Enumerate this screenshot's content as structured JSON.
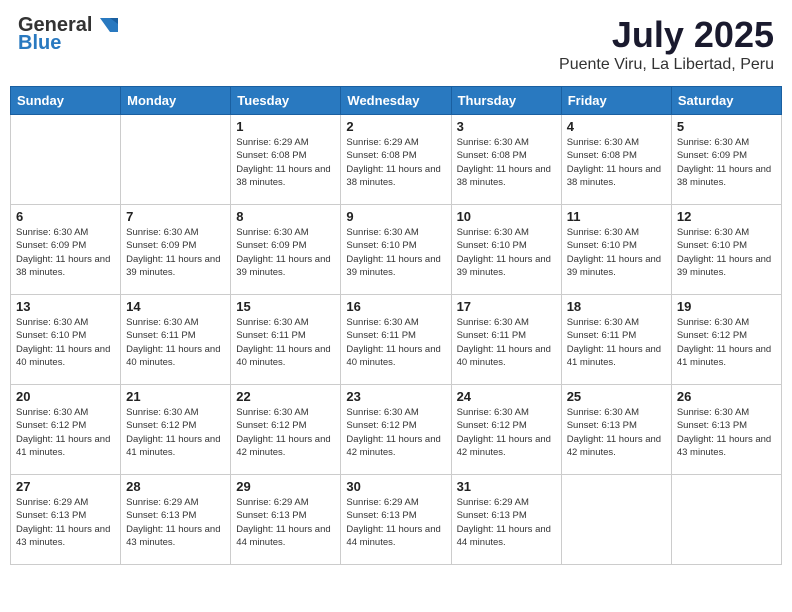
{
  "header": {
    "logo_general": "General",
    "logo_blue": "Blue",
    "title": "July 2025",
    "subtitle": "Puente Viru, La Libertad, Peru"
  },
  "days_of_week": [
    "Sunday",
    "Monday",
    "Tuesday",
    "Wednesday",
    "Thursday",
    "Friday",
    "Saturday"
  ],
  "weeks": [
    [
      {
        "num": "",
        "info": ""
      },
      {
        "num": "",
        "info": ""
      },
      {
        "num": "1",
        "info": "Sunrise: 6:29 AM\nSunset: 6:08 PM\nDaylight: 11 hours and 38 minutes."
      },
      {
        "num": "2",
        "info": "Sunrise: 6:29 AM\nSunset: 6:08 PM\nDaylight: 11 hours and 38 minutes."
      },
      {
        "num": "3",
        "info": "Sunrise: 6:30 AM\nSunset: 6:08 PM\nDaylight: 11 hours and 38 minutes."
      },
      {
        "num": "4",
        "info": "Sunrise: 6:30 AM\nSunset: 6:08 PM\nDaylight: 11 hours and 38 minutes."
      },
      {
        "num": "5",
        "info": "Sunrise: 6:30 AM\nSunset: 6:09 PM\nDaylight: 11 hours and 38 minutes."
      }
    ],
    [
      {
        "num": "6",
        "info": "Sunrise: 6:30 AM\nSunset: 6:09 PM\nDaylight: 11 hours and 38 minutes."
      },
      {
        "num": "7",
        "info": "Sunrise: 6:30 AM\nSunset: 6:09 PM\nDaylight: 11 hours and 39 minutes."
      },
      {
        "num": "8",
        "info": "Sunrise: 6:30 AM\nSunset: 6:09 PM\nDaylight: 11 hours and 39 minutes."
      },
      {
        "num": "9",
        "info": "Sunrise: 6:30 AM\nSunset: 6:10 PM\nDaylight: 11 hours and 39 minutes."
      },
      {
        "num": "10",
        "info": "Sunrise: 6:30 AM\nSunset: 6:10 PM\nDaylight: 11 hours and 39 minutes."
      },
      {
        "num": "11",
        "info": "Sunrise: 6:30 AM\nSunset: 6:10 PM\nDaylight: 11 hours and 39 minutes."
      },
      {
        "num": "12",
        "info": "Sunrise: 6:30 AM\nSunset: 6:10 PM\nDaylight: 11 hours and 39 minutes."
      }
    ],
    [
      {
        "num": "13",
        "info": "Sunrise: 6:30 AM\nSunset: 6:10 PM\nDaylight: 11 hours and 40 minutes."
      },
      {
        "num": "14",
        "info": "Sunrise: 6:30 AM\nSunset: 6:11 PM\nDaylight: 11 hours and 40 minutes."
      },
      {
        "num": "15",
        "info": "Sunrise: 6:30 AM\nSunset: 6:11 PM\nDaylight: 11 hours and 40 minutes."
      },
      {
        "num": "16",
        "info": "Sunrise: 6:30 AM\nSunset: 6:11 PM\nDaylight: 11 hours and 40 minutes."
      },
      {
        "num": "17",
        "info": "Sunrise: 6:30 AM\nSunset: 6:11 PM\nDaylight: 11 hours and 40 minutes."
      },
      {
        "num": "18",
        "info": "Sunrise: 6:30 AM\nSunset: 6:11 PM\nDaylight: 11 hours and 41 minutes."
      },
      {
        "num": "19",
        "info": "Sunrise: 6:30 AM\nSunset: 6:12 PM\nDaylight: 11 hours and 41 minutes."
      }
    ],
    [
      {
        "num": "20",
        "info": "Sunrise: 6:30 AM\nSunset: 6:12 PM\nDaylight: 11 hours and 41 minutes."
      },
      {
        "num": "21",
        "info": "Sunrise: 6:30 AM\nSunset: 6:12 PM\nDaylight: 11 hours and 41 minutes."
      },
      {
        "num": "22",
        "info": "Sunrise: 6:30 AM\nSunset: 6:12 PM\nDaylight: 11 hours and 42 minutes."
      },
      {
        "num": "23",
        "info": "Sunrise: 6:30 AM\nSunset: 6:12 PM\nDaylight: 11 hours and 42 minutes."
      },
      {
        "num": "24",
        "info": "Sunrise: 6:30 AM\nSunset: 6:12 PM\nDaylight: 11 hours and 42 minutes."
      },
      {
        "num": "25",
        "info": "Sunrise: 6:30 AM\nSunset: 6:13 PM\nDaylight: 11 hours and 42 minutes."
      },
      {
        "num": "26",
        "info": "Sunrise: 6:30 AM\nSunset: 6:13 PM\nDaylight: 11 hours and 43 minutes."
      }
    ],
    [
      {
        "num": "27",
        "info": "Sunrise: 6:29 AM\nSunset: 6:13 PM\nDaylight: 11 hours and 43 minutes."
      },
      {
        "num": "28",
        "info": "Sunrise: 6:29 AM\nSunset: 6:13 PM\nDaylight: 11 hours and 43 minutes."
      },
      {
        "num": "29",
        "info": "Sunrise: 6:29 AM\nSunset: 6:13 PM\nDaylight: 11 hours and 44 minutes."
      },
      {
        "num": "30",
        "info": "Sunrise: 6:29 AM\nSunset: 6:13 PM\nDaylight: 11 hours and 44 minutes."
      },
      {
        "num": "31",
        "info": "Sunrise: 6:29 AM\nSunset: 6:13 PM\nDaylight: 11 hours and 44 minutes."
      },
      {
        "num": "",
        "info": ""
      },
      {
        "num": "",
        "info": ""
      }
    ]
  ]
}
